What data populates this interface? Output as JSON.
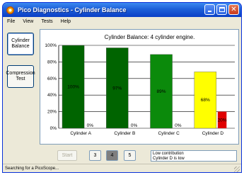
{
  "window": {
    "title": "Pico Diagnostics - Cylinder Balance"
  },
  "titlebar_buttons": {
    "minimize": "minimize",
    "maximize": "maximize",
    "close": "✕"
  },
  "menu": [
    "File",
    "View",
    "Tests",
    "Help"
  ],
  "sidebar": {
    "cylinder_balance": "Cylinder Balance",
    "compression_test": "Compression Test"
  },
  "chart_data": {
    "type": "bar",
    "title": "Cylinder Balance: 4 cylinder engine.",
    "categories": [
      "Cylinder A",
      "Cylinder B",
      "Cylinder C",
      "Cylinder D"
    ],
    "series": [
      {
        "values": [
          100,
          97,
          89,
          68
        ],
        "labels": [
          "100%",
          "97%",
          "89%",
          "68%"
        ]
      },
      {
        "values": [
          0,
          0,
          0,
          20
        ],
        "labels": [
          "0%",
          "0%",
          "0%",
          "20%"
        ]
      }
    ],
    "colors": {
      "bars": [
        "#006400",
        "#006400",
        "#0b8a0b",
        "#ffff00"
      ],
      "secondary": "#e00000",
      "grid": "#000000"
    },
    "ylim": [
      0,
      100
    ],
    "yticks": [
      "0%",
      "20%",
      "40%",
      "60%",
      "80%",
      "100%"
    ],
    "grid": true
  },
  "controls": {
    "start": "Start",
    "cyl3": "3",
    "cyl4": "4",
    "cyl5": "5",
    "selected": "4"
  },
  "info": {
    "line1": "Low contribution",
    "line2": "Cylinder D is low"
  },
  "status": "Searching for a PicoScope..."
}
